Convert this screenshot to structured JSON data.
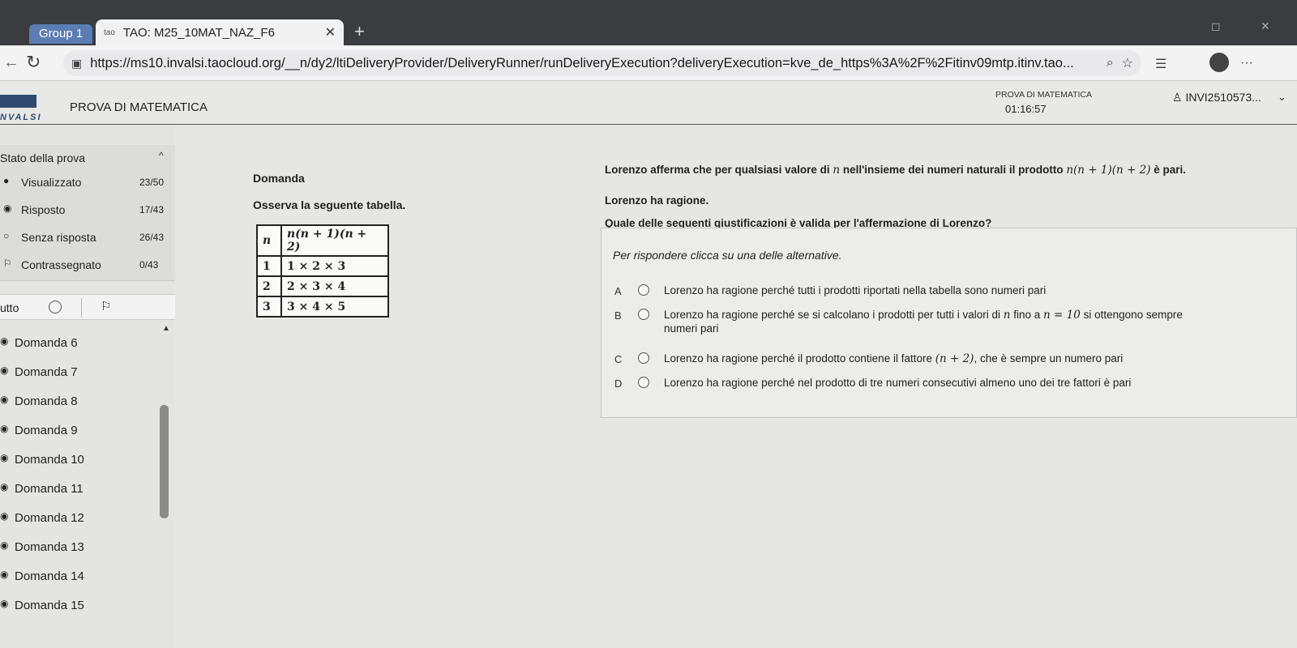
{
  "browser": {
    "tab_group": "Group 1",
    "tab_favicon": "tao",
    "tab_title": "TAO: M25_10MAT_NAZ_F6",
    "url": "https://ms10.invalsi.taocloud.org/__n/dy2/ltiDeliveryProvider/DeliveryRunner/runDeliveryExecution?deliveryExecution=kve_de_https%3A%2F%2Fitinv09mtp.itinv.tao..."
  },
  "header": {
    "logo_text": "NVALSI",
    "title": "PROVA DI MATEMATICA",
    "timer_label": "PROVA DI MATEMATICA",
    "timer": "01:16:57",
    "user": "INVI2510573..."
  },
  "sidebar": {
    "state_title": "Stato della prova",
    "states": [
      {
        "label": "Visualizzato",
        "count": "23/50"
      },
      {
        "label": "Risposto",
        "count": "17/43"
      },
      {
        "label": "Senza risposta",
        "count": "26/43"
      },
      {
        "label": "Contrassegnato",
        "count": "0/43"
      }
    ],
    "filter_all": "utto",
    "questions": [
      "Domanda 6",
      "Domanda 7",
      "Domanda 8",
      "Domanda 9",
      "Domanda 10",
      "Domanda 11",
      "Domanda 12",
      "Domanda 13",
      "Domanda 14",
      "Domanda 15"
    ]
  },
  "question": {
    "section_title": "Domanda",
    "table_intro": "Osserva la seguente tabella.",
    "table": {
      "headers": [
        "n",
        "n(n + 1)(n + 2)"
      ],
      "rows": [
        [
          "1",
          "1 × 2 × 3"
        ],
        [
          "2",
          "2 × 3 × 4"
        ],
        [
          "3",
          "3 × 4 × 5"
        ]
      ]
    },
    "statement_pre": "Lorenzo afferma che per qualsiasi valore di",
    "statement_var": "n",
    "statement_mid": "nell'insieme dei numeri naturali il prodotto",
    "statement_expr": "n(n + 1)(n + 2)",
    "statement_post": "è pari.",
    "claim": "Lorenzo ha ragione.",
    "ask": "Quale delle seguenti giustificazioni è valida per l'affermazione di Lorenzo?",
    "instruction": "Per rispondere clicca su una delle alternative.",
    "choices": [
      {
        "letter": "A",
        "text": "Lorenzo ha ragione perché tutti i prodotti riportati nella tabella sono numeri pari"
      },
      {
        "letter": "B",
        "text": "Lorenzo ha ragione perché se si calcolano i prodotti per tutti i valori di",
        "var": "n",
        "mid": "fino a",
        "expr": "n = 10",
        "post": "si ottengono sempre",
        "line2": "numeri pari"
      },
      {
        "letter": "C",
        "text": "Lorenzo ha ragione perché il prodotto contiene il fattore",
        "expr": "(n + 2)",
        "post": ", che è sempre un numero pari"
      },
      {
        "letter": "D",
        "text": "Lorenzo ha ragione perché nel prodotto di tre numeri consecutivi almeno uno dei tre fattori è pari"
      }
    ]
  }
}
